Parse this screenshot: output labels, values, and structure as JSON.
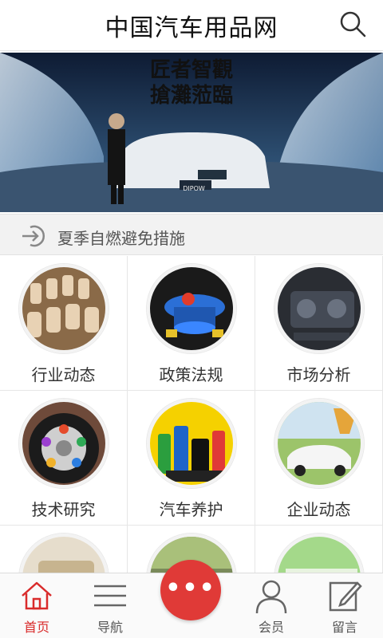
{
  "header": {
    "title": "中国汽车用品网",
    "search_icon": "search-icon"
  },
  "banner": {
    "line1": "匠者智觀",
    "line2": "搶灘蒞臨",
    "plate": "DIPOW"
  },
  "notice": {
    "icon": "arrow-enter-icon",
    "text": "夏季自燃避免措施"
  },
  "grid": {
    "items": [
      {
        "label": "行业动态",
        "icon": "car-seats-image"
      },
      {
        "label": "政策法规",
        "icon": "blue-parts-image"
      },
      {
        "label": "市场分析",
        "icon": "engine-image"
      },
      {
        "label": "技术研究",
        "icon": "wheel-image"
      },
      {
        "label": "汽车养护",
        "icon": "care-products-image"
      },
      {
        "label": "企业动态",
        "icon": "car-park-image"
      },
      {
        "label": "",
        "icon": "interior-image"
      },
      {
        "label": "",
        "icon": "road-image"
      },
      {
        "label": "",
        "icon": "green-image"
      }
    ]
  },
  "bottom_nav": {
    "items": [
      {
        "label": "首页",
        "icon": "home-icon",
        "active": true
      },
      {
        "label": "导航",
        "icon": "menu-icon",
        "active": false
      },
      {
        "label": "会员",
        "icon": "user-icon",
        "active": false
      },
      {
        "label": "留言",
        "icon": "edit-icon",
        "active": false
      }
    ],
    "fab_text": "•••"
  },
  "colors": {
    "accent": "#e03a37",
    "active_tab": "#d92b2b"
  }
}
